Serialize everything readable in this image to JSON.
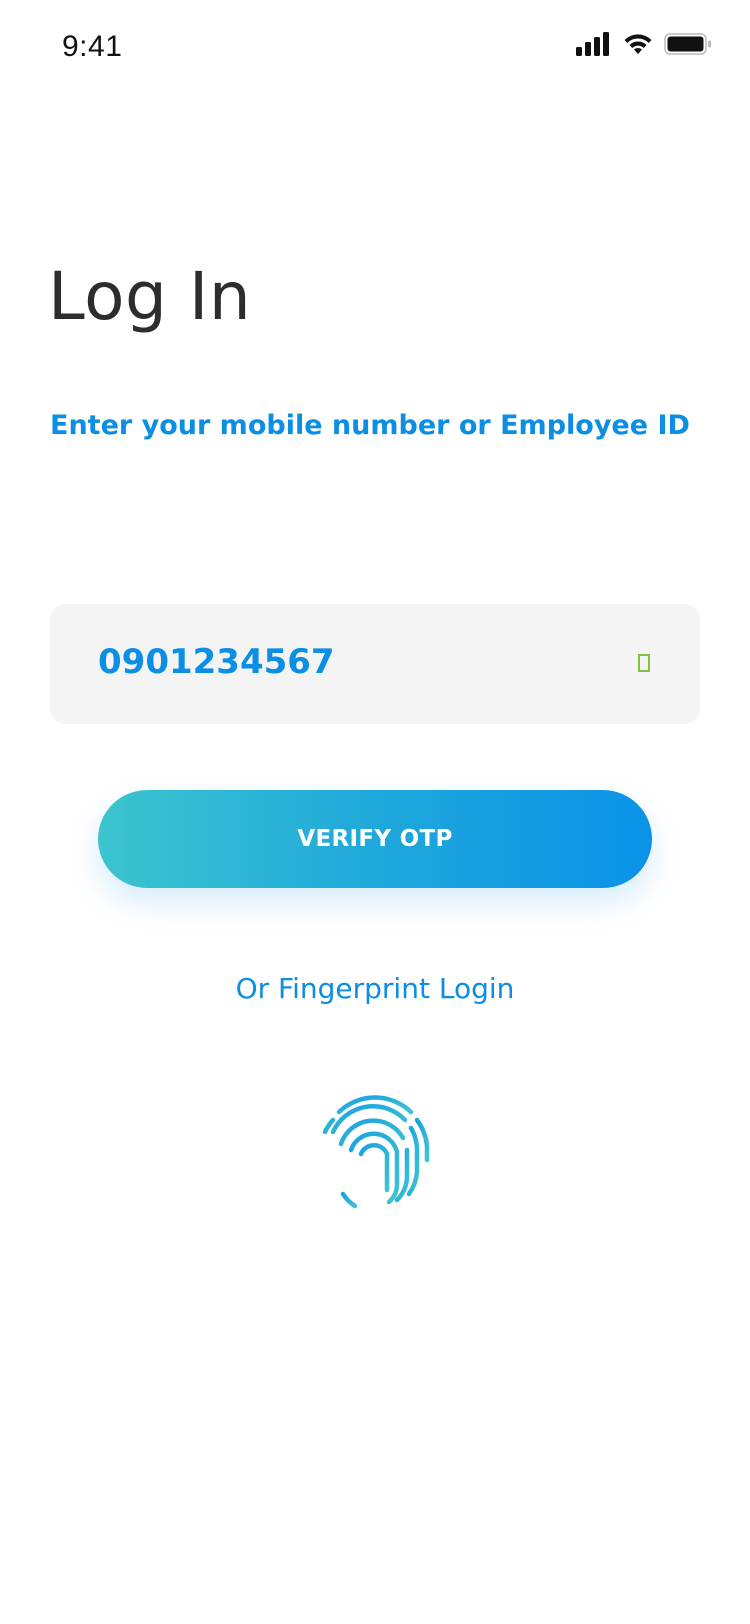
{
  "status_bar": {
    "time": "9:41"
  },
  "login": {
    "title": "Log In",
    "subtitle": "Enter your mobile number or Employee ID",
    "input_value": "0901234567",
    "verify_button_label": "VERIFY OTP",
    "fingerprint_link": "Or Fingerprint Login"
  },
  "icons": {
    "cellular": "cellular-signal-icon",
    "wifi": "wifi-icon",
    "battery": "battery-icon",
    "input_status": "validation-indicator-icon",
    "fingerprint": "fingerprint-icon"
  },
  "colors": {
    "accent": "#0b8ee3",
    "gradient_start": "#3cc4cf",
    "gradient_end": "#0a92e8",
    "input_bg": "#f4f4f4",
    "title": "#2d2d2d",
    "valid": "#7fc242"
  }
}
